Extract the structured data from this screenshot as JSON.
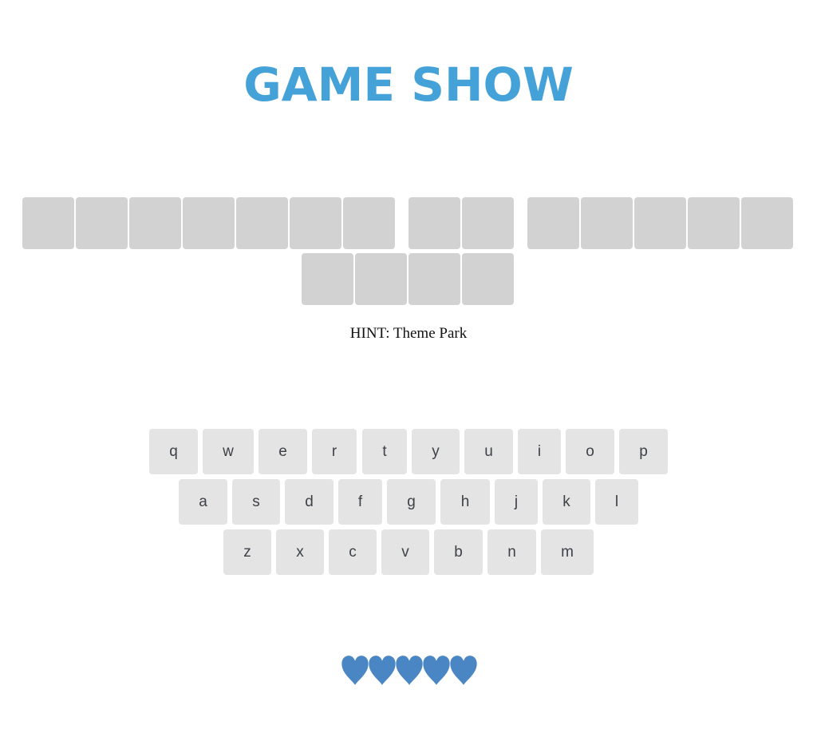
{
  "title": "GAME SHOW",
  "colors": {
    "title": "#45a2d8",
    "tile": "#d2d2d2",
    "key_bg": "#e4e4e4",
    "key_text": "#3d4148",
    "heart": "#4a86c4"
  },
  "phrase": {
    "words": [
      {
        "letters": 7
      },
      {
        "letters": 2
      },
      {
        "letters": 5
      },
      {
        "letters": 4
      }
    ]
  },
  "hint": "HINT: Theme Park",
  "keyboard": {
    "rows": [
      [
        "q",
        "w",
        "e",
        "r",
        "t",
        "y",
        "u",
        "i",
        "o",
        "p"
      ],
      [
        "a",
        "s",
        "d",
        "f",
        "g",
        "h",
        "j",
        "k",
        "l"
      ],
      [
        "z",
        "x",
        "c",
        "v",
        "b",
        "n",
        "m"
      ]
    ]
  },
  "lives": {
    "total": 5,
    "remaining": 5,
    "icon": "heart-icon"
  }
}
